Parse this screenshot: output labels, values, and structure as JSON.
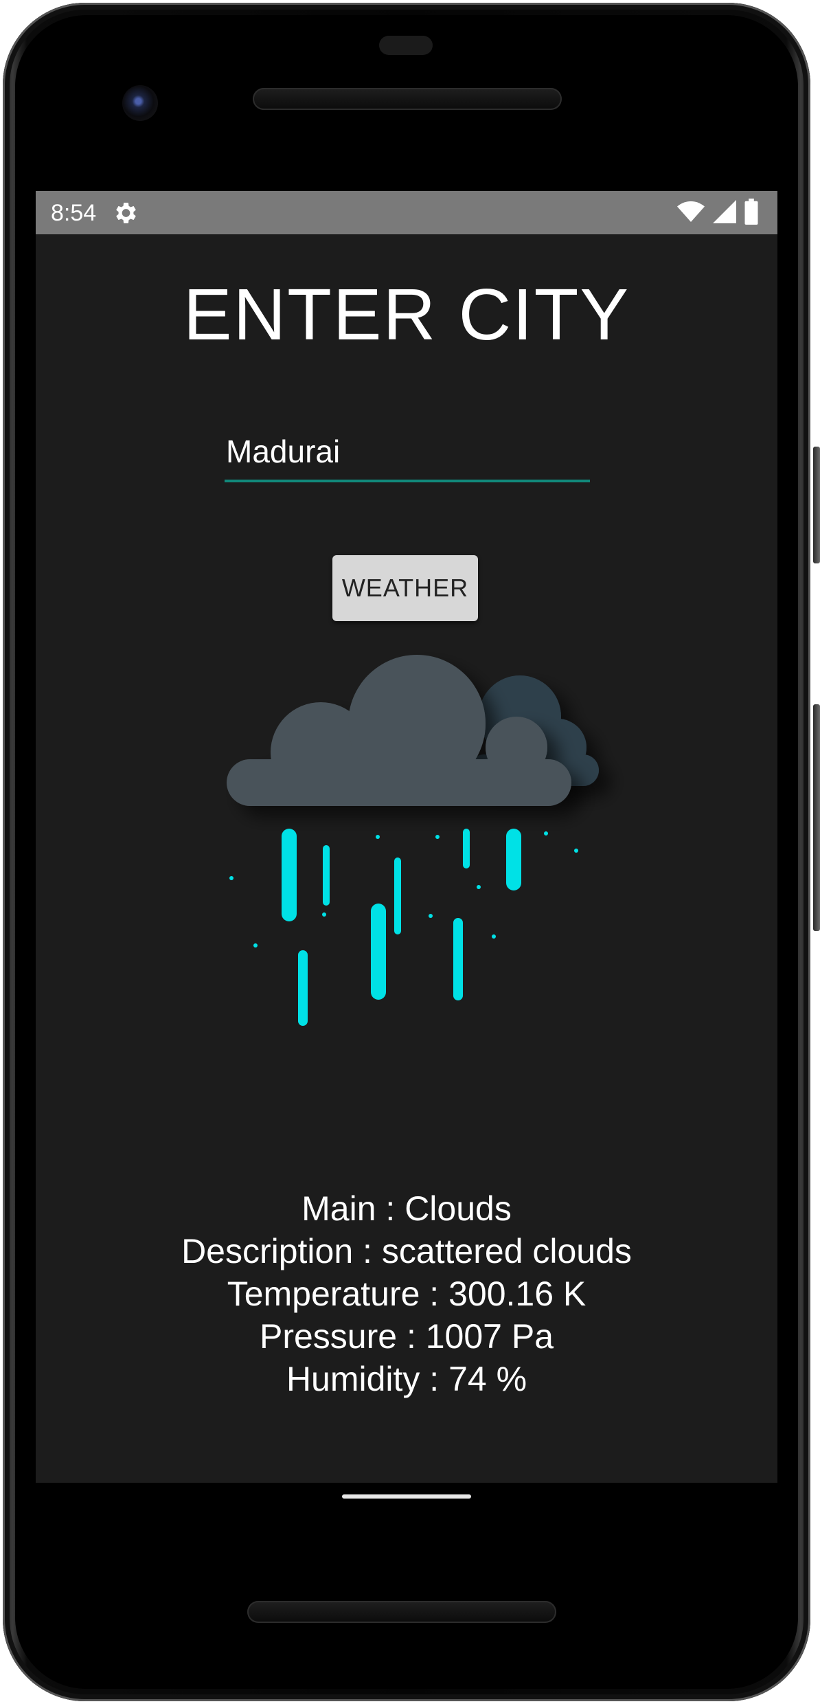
{
  "status_bar": {
    "time": "8:54",
    "icons": [
      "settings-icon",
      "wifi-icon",
      "cell-signal-icon",
      "battery-icon"
    ]
  },
  "screen": {
    "title": "ENTER CITY",
    "city_input": {
      "value": "Madurai",
      "accent_color": "#11897b"
    },
    "weather_button_label": "WEATHER",
    "illustration": "rain-cloud-icon",
    "info_lines": {
      "main": "Main : Clouds",
      "description": "Description : scattered clouds",
      "temperature": "Temperature : 300.16 K",
      "pressure": "Pressure : 1007 Pa",
      "humidity": "Humidity : 74 %"
    }
  },
  "colors": {
    "background": "#1c1c1c",
    "status_bar": "#7a7a7a",
    "rain": "#00e1e6",
    "cloud_front": "#4a535a",
    "cloud_back": "#2e3f4b"
  }
}
